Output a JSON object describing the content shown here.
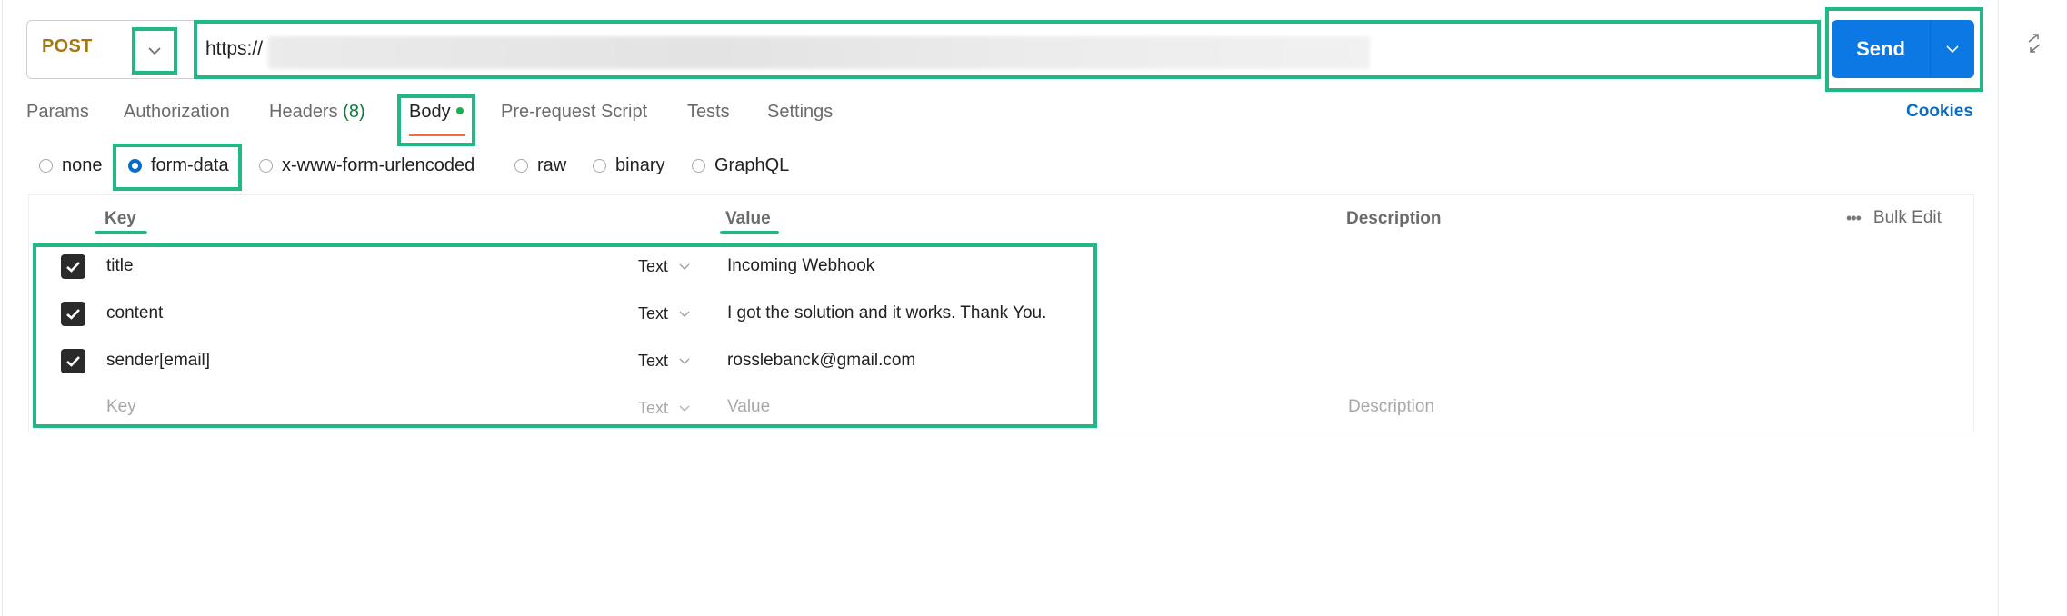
{
  "request": {
    "method": "POST",
    "url_visible": "https://",
    "url_redacted": true,
    "send_label": "Send"
  },
  "tabs": [
    {
      "label": "Params"
    },
    {
      "label": "Authorization"
    },
    {
      "label": "Headers",
      "count": "(8)"
    },
    {
      "label": "Body",
      "active": true,
      "has_content_dot": true
    },
    {
      "label": "Pre-request Script"
    },
    {
      "label": "Tests"
    },
    {
      "label": "Settings"
    }
  ],
  "cookies_label": "Cookies",
  "body_types": [
    {
      "label": "none",
      "selected": false
    },
    {
      "label": "form-data",
      "selected": true
    },
    {
      "label": "x-www-form-urlencoded",
      "selected": false
    },
    {
      "label": "raw",
      "selected": false
    },
    {
      "label": "binary",
      "selected": false
    },
    {
      "label": "GraphQL",
      "selected": false
    }
  ],
  "table": {
    "headers": {
      "key": "Key",
      "value": "Value",
      "description": "Description"
    },
    "bulk_edit_label": "Bulk Edit",
    "rows": [
      {
        "checked": true,
        "key": "title",
        "type": "Text",
        "value": "Incoming Webhook",
        "description": ""
      },
      {
        "checked": true,
        "key": "content",
        "type": "Text",
        "value": "I got the solution and it works. Thank You.",
        "description": ""
      },
      {
        "checked": true,
        "key": "sender[email]",
        "type": "Text",
        "value": "rosslebanck@gmail.com",
        "description": ""
      }
    ],
    "new_row": {
      "key_placeholder": "Key",
      "type": "Text",
      "value_placeholder": "Value",
      "description_placeholder": "Description"
    }
  },
  "colors": {
    "highlight": "#22b882",
    "send_button": "#0b78e3",
    "method_post": "#a5780f",
    "active_tab_underline": "#f26b3a",
    "link": "#0b6cc4"
  }
}
